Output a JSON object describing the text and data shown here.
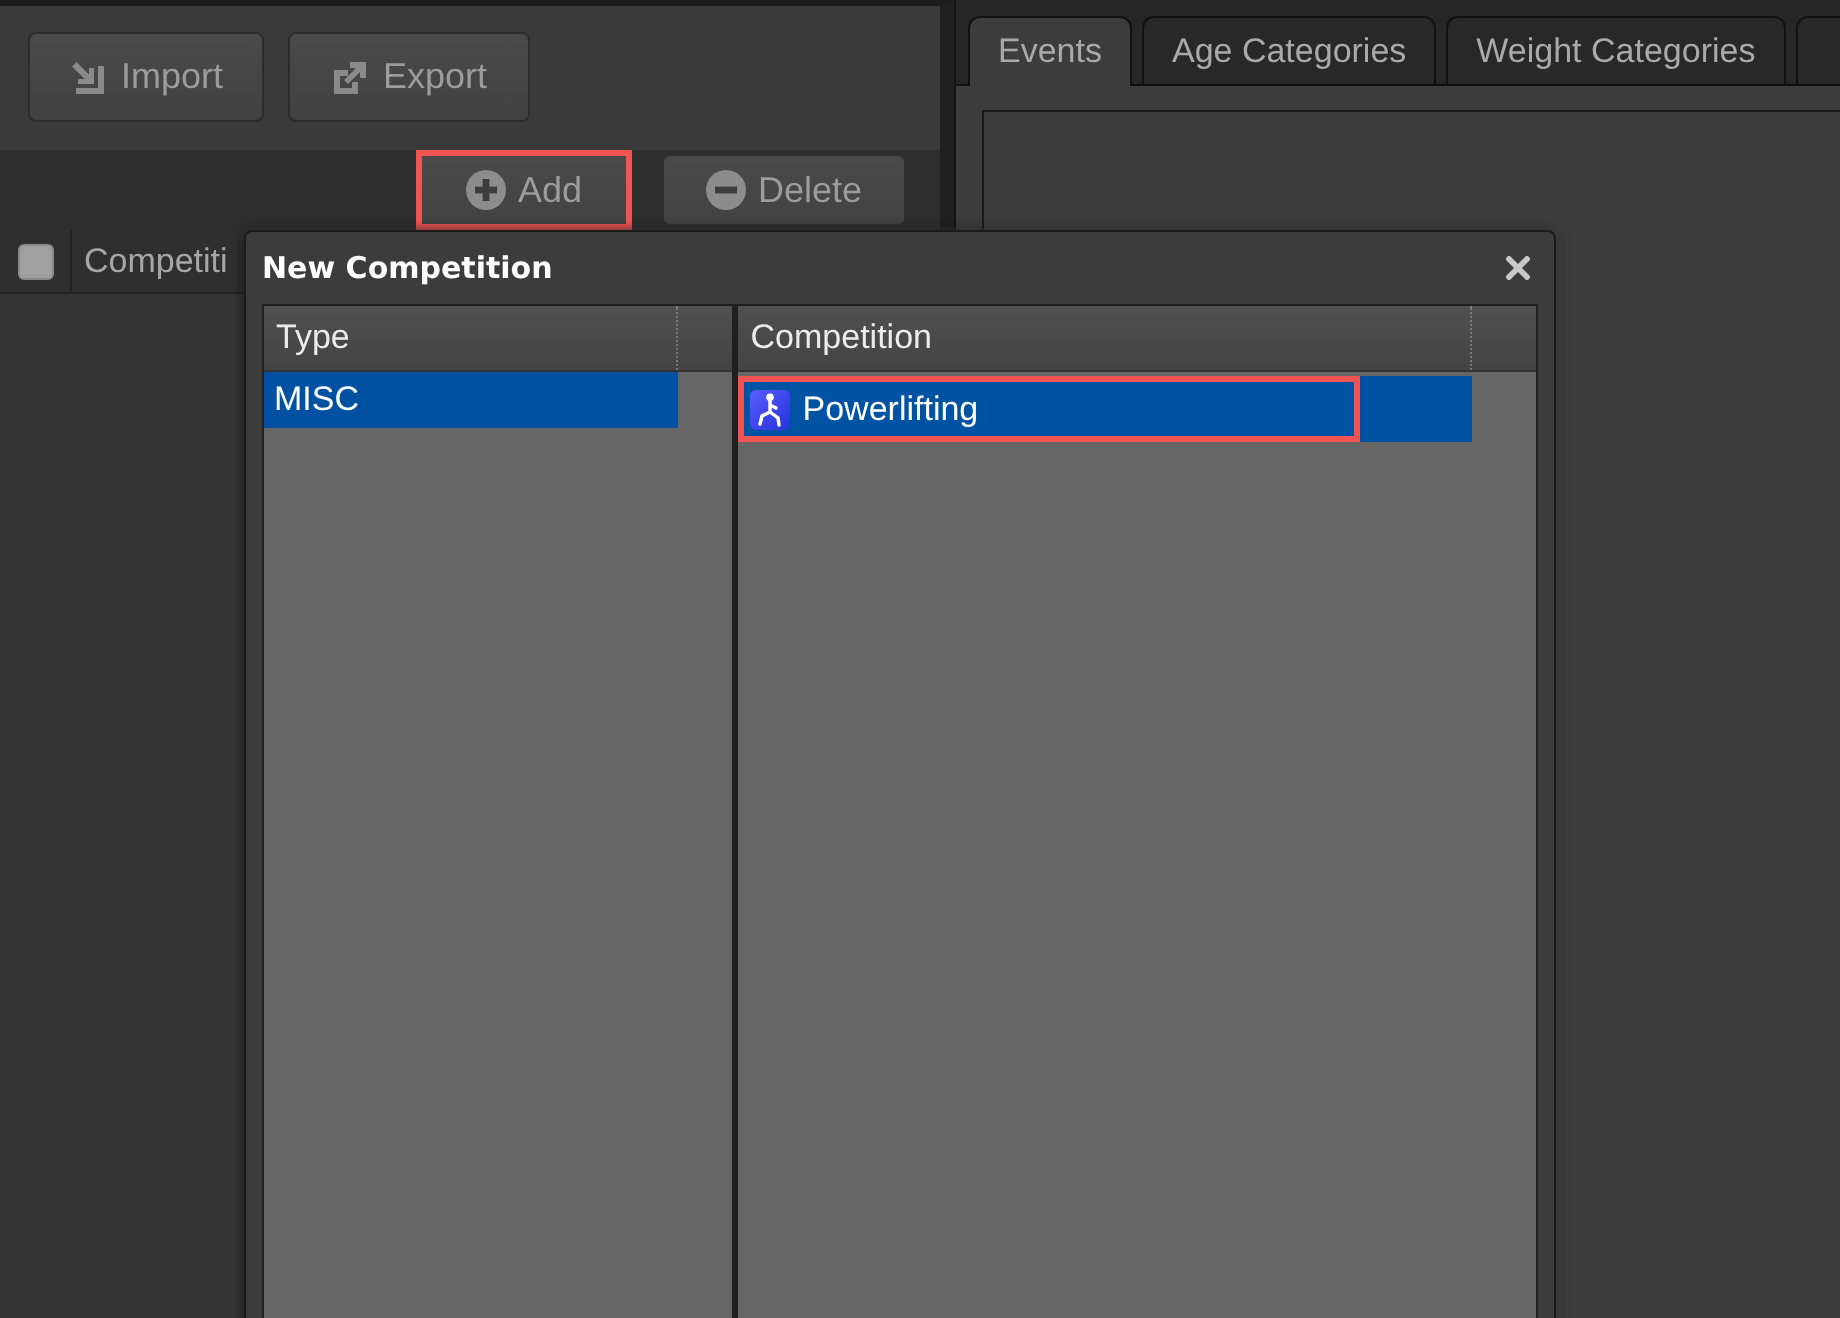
{
  "left_panel": {
    "toolbar": [
      {
        "label": "Import",
        "kind": "import"
      },
      {
        "label": "Export",
        "kind": "export"
      }
    ],
    "actions": [
      {
        "label": "Add",
        "kind": "add",
        "highlighted": true
      },
      {
        "label": "Delete",
        "kind": "delete",
        "highlighted": false
      }
    ],
    "table": {
      "select_all_checked": false,
      "columns": [
        "Competiti"
      ]
    }
  },
  "tabs": [
    {
      "label": "Events",
      "selected": true
    },
    {
      "label": "Age Categories",
      "selected": false
    },
    {
      "label": "Weight Categories",
      "selected": false
    },
    {
      "selected": false
    }
  ],
  "dialog": {
    "title": "New Competition",
    "type_table": {
      "columns": [
        "Type"
      ],
      "rows": [
        {
          "cell": "MISC",
          "selected": true,
          "highlighted": false
        }
      ]
    },
    "competition_table": {
      "columns": [
        "Competition"
      ],
      "rows": [
        {
          "cell": "Powerlifting",
          "selected": true,
          "highlighted": true
        }
      ]
    }
  }
}
